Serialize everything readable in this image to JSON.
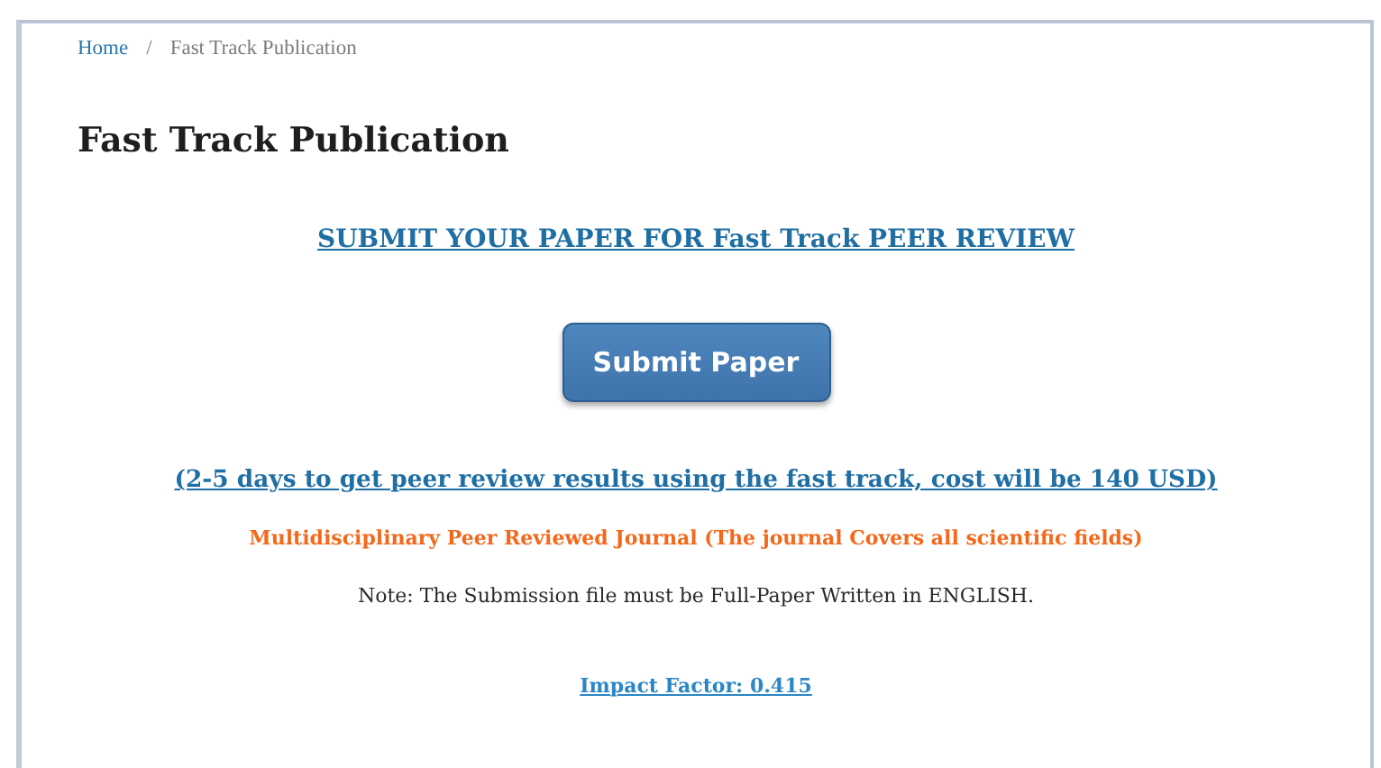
{
  "breadcrumb": [
    {
      "label": "Home",
      "kind": "link"
    },
    {
      "label": "/",
      "kind": "separator"
    },
    {
      "label": "Fast Track Publication",
      "kind": "current"
    }
  ],
  "title": "Fast Track Publication",
  "headline_link": "SUBMIT YOUR PAPER FOR Fast Track PEER REVIEW",
  "submit_button": "Submit Paper",
  "pricing_link": "(2-5 days to get peer review results using the fast track, cost will be 140 USD)",
  "journal_note": "Multidisciplinary Peer Reviewed Journal (The journal Covers all scientific fields)",
  "submission_note": "Note: The Submission file must be Full-Paper Written in ENGLISH.",
  "impact_link": "Impact Factor: 0.415"
}
